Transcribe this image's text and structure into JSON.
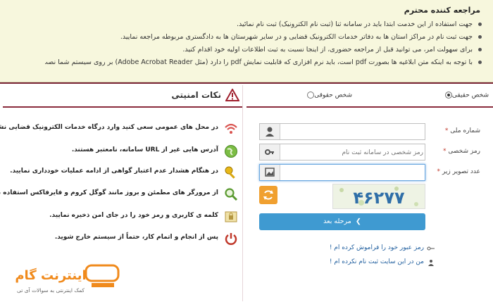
{
  "notice": {
    "title": "مراجعه کننده محترم",
    "items": [
      "جهت استفاده از این خدمت ابتدا باید در سامانه ثنا (ثبت نام الکترونیک) ثبت نام نمائید.",
      "جهت ثبت نام در مراکز استان ها به دفاتر خدمات الکترونیک قضایی و در سایر شهرستان ها به دادگستری مربوطه مراجعه نمایید.",
      "برای سهولت امر، می توانید قبل از مراجعه حضوری، از اینجا نسبت به ثبت اطلاعات اولیه خود اقدام کنید.",
      "با توجه به اینکه متن ابلاغیه ها بصورت pdf است، باید نرم افزاری که قابلیت نمایش pdf را دارد (مثل Adobe Acrobat Reader) بر روی سیستم شما نصب شده باشد."
    ]
  },
  "security": {
    "title": "نکات امنیتی",
    "tips": [
      {
        "icon": "wifi-icon",
        "text": "در محل های عمومی سعی کنید وارد درگاه خدمات الکترونیک قضایی نشوید."
      },
      {
        "icon": "globe-icon",
        "text": "آدرس هایی غیر از URL سامانه، نامعتبر هستند."
      },
      {
        "icon": "key-icon",
        "text": "در هنگام هشدار عدم اعتبار گواهی از ادامه عملیات خودداری نمایید."
      },
      {
        "icon": "magnifier-icon",
        "text": "از مرورگر های مطمئن و بروز مانند گوگل کروم و فایرفاکس استفاده نمایید."
      },
      {
        "icon": "lock-icon",
        "text": "کلمه ی کاربری و رمز خود را در جای امن ذخیره نمایید."
      },
      {
        "icon": "power-icon",
        "text": "پس از انجام و اتمام کار، حتماً از سیستم خارج شوید."
      }
    ]
  },
  "login": {
    "type_real": "شخص حقیقی",
    "type_legal": "شخص حقوقی",
    "national_id_label": "شماره ملی",
    "password_label": "رمز شخصی",
    "password_placeholder": "رمز شخصی در سامانه ثبت نام",
    "captcha_label": "عدد تصویر زیر",
    "captcha_value": "۴۶۲۷۷",
    "submit_label": "مرحله بعد",
    "forgot_link": "رمز عبور خود را فراموش کرده ام !",
    "register_link": "من در این سایت ثبت نام نکرده ام !"
  },
  "logo": {
    "name": "اینترنت گام",
    "tagline": "کمک اینترنتی به سوالات آی تی"
  },
  "colors": {
    "accent": "#8a2c3c",
    "button": "#3f9ad1",
    "notice_bg": "#f7f7dd",
    "link": "#1f5e9e"
  }
}
